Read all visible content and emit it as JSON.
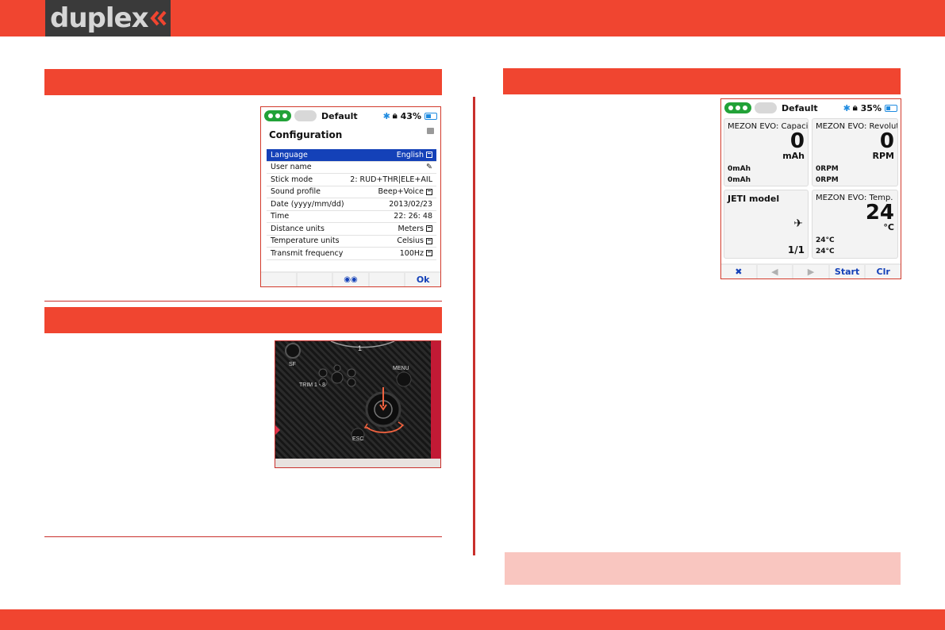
{
  "brand": {
    "logo_text": "duplex",
    "logo_color": "#d6d6d6",
    "accent": "#f04530"
  },
  "config_screen": {
    "status": {
      "model": "Default",
      "battery_text": "43%",
      "battery_level": 0.43
    },
    "title": "Configuration",
    "rows": [
      {
        "label": "Language",
        "value": "English",
        "selected": true
      },
      {
        "label": "User name",
        "value": ""
      },
      {
        "label": "Stick mode",
        "value": "2: RUD+THR|ELE+AIL"
      },
      {
        "label": "Sound profile",
        "value": "Beep+Voice"
      },
      {
        "label": "Date (yyyy/mm/dd)",
        "value": "2013/02/23"
      },
      {
        "label": "Time",
        "value": "22: 26: 48"
      },
      {
        "label": "Distance units",
        "value": "Meters"
      },
      {
        "label": "Temperature units",
        "value": "Celsius"
      },
      {
        "label": "Transmit frequency",
        "value": "100Hz"
      }
    ],
    "softkey_ok": "Ok"
  },
  "photo": {
    "labels": {
      "sf": "SF",
      "menu": "MENU",
      "trim": "TRIM 1 - 8",
      "esc": "ESC",
      "number": "1"
    }
  },
  "telemetry_screen": {
    "status": {
      "model": "Default",
      "battery_text": "35%",
      "battery_level": 0.35
    },
    "tiles": {
      "capacity": {
        "title": "MEZON EVO: Capacity",
        "value": "0",
        "unit": "mAh",
        "min": "0mAh",
        "max": "0mAh"
      },
      "revolution": {
        "title": "MEZON EVO: Revolutio",
        "value": "0",
        "unit": "RPM",
        "min": "0RPM",
        "max": "0RPM"
      },
      "model": {
        "title": "JETI model",
        "page": "1/1"
      },
      "temp": {
        "title": "MEZON EVO: Temp.",
        "value": "24",
        "unit": "°C",
        "min": "24°C",
        "max": "24°C"
      }
    },
    "softkeys": {
      "start": "Start",
      "clear": "Clr"
    }
  }
}
